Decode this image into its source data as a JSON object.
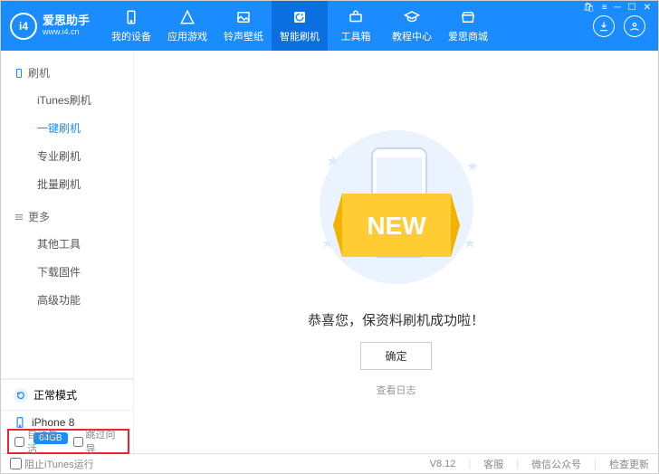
{
  "brand": {
    "glyph": "i4",
    "name": "爱思助手",
    "url": "www.i4.cn"
  },
  "nav": {
    "items": [
      {
        "label": "我的设备"
      },
      {
        "label": "应用游戏"
      },
      {
        "label": "铃声壁纸"
      },
      {
        "label": "智能刷机"
      },
      {
        "label": "工具箱"
      },
      {
        "label": "教程中心"
      },
      {
        "label": "爱思商城"
      }
    ],
    "activeIndex": 3
  },
  "sidebar": {
    "sectionFlash": "刷机",
    "flashItems": [
      "iTunes刷机",
      "一键刷机",
      "专业刷机",
      "批量刷机"
    ],
    "flashActive": 1,
    "sectionMore": "更多",
    "moreItems": [
      "其他工具",
      "下载固件",
      "高级功能"
    ],
    "status": "正常模式",
    "device": {
      "name": "iPhone 8",
      "capacity": "64GB"
    }
  },
  "main": {
    "ribbonText": "NEW",
    "successMsg": "恭喜您，保资料刷机成功啦！",
    "okBtn": "确定",
    "viewLog": "查看日志"
  },
  "footChecks": {
    "autoActivate": "自动激活",
    "skipSetup": "跳过向导"
  },
  "statusbar": {
    "blockItunes": "阻止iTunes运行",
    "version": "V8.12",
    "support": "客服",
    "wechat": "微信公众号",
    "checkUpdate": "检查更新"
  }
}
